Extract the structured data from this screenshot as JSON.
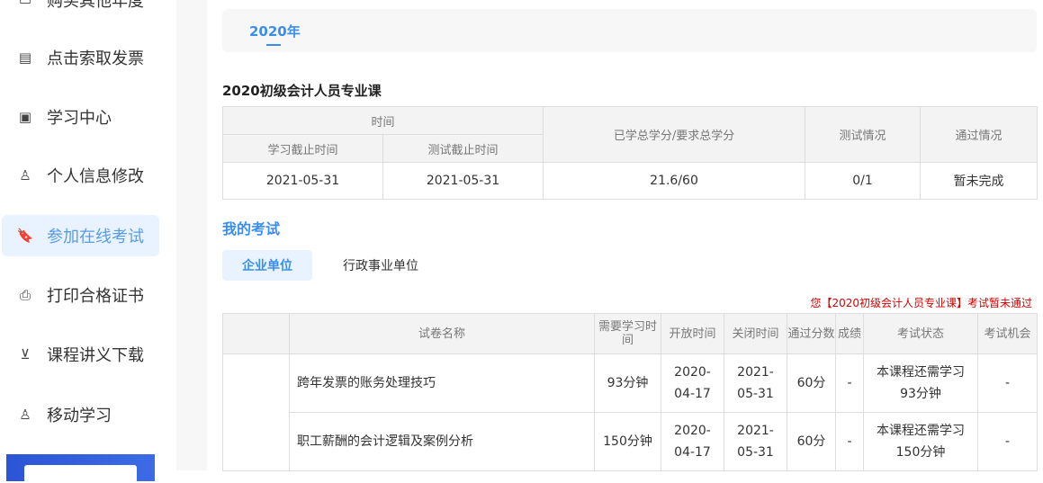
{
  "sidebar": {
    "items": [
      {
        "label": "购买其他年度",
        "icon": "card-icon"
      },
      {
        "label": "点击索取发票",
        "icon": "invoice-icon"
      },
      {
        "label": "学习中心",
        "icon": "monitor-icon"
      },
      {
        "label": "个人信息修改",
        "icon": "user-icon"
      },
      {
        "label": "参加在线考试",
        "icon": "bookmark-icon",
        "active": true
      },
      {
        "label": "打印合格证书",
        "icon": "printer-icon"
      },
      {
        "label": "课程讲义下载",
        "icon": "download-icon"
      },
      {
        "label": "移动学习",
        "icon": "user-icon"
      }
    ]
  },
  "year_tab": "2020年",
  "course": {
    "title": "2020初级会计人员专业课",
    "headers": {
      "time": "时间",
      "study_deadline": "学习截止时间",
      "test_deadline": "测试截止时间",
      "credits": "已学总学分/要求总学分",
      "test": "测试情况",
      "pass": "通过情况"
    },
    "row": {
      "study_deadline": "2021-05-31",
      "test_deadline": "2021-05-31",
      "credits": "21.6/60",
      "test": "0/1",
      "pass": "暂未完成"
    }
  },
  "my_exam": {
    "title": "我的考试",
    "tabs": [
      "企业单位",
      "行政事业单位"
    ],
    "notice": "您【2020初级会计人员专业课】考试暂未通过",
    "headers": [
      "试卷名称",
      "需要学习时间",
      "开放时间",
      "关闭时间",
      "通过分数",
      "成绩",
      "考试状态",
      "考试机会"
    ],
    "rows": [
      {
        "name": "跨年发票的账务处理技巧",
        "study": "93分钟",
        "open1": "2020-",
        "open2": "04-17",
        "close1": "2021-",
        "close2": "05-31",
        "pass": "60分",
        "score": "-",
        "status1": "本课程还需学习",
        "status2": "93分钟",
        "chance": "-"
      },
      {
        "name": "职工薪酬的会计逻辑及案例分析",
        "study": "150分钟",
        "open1": "2020-",
        "open2": "04-17",
        "close1": "2021-",
        "close2": "05-31",
        "pass": "60分",
        "score": "-",
        "status1": "本课程还需学习",
        "status2": "150分钟",
        "chance": "-"
      }
    ]
  }
}
